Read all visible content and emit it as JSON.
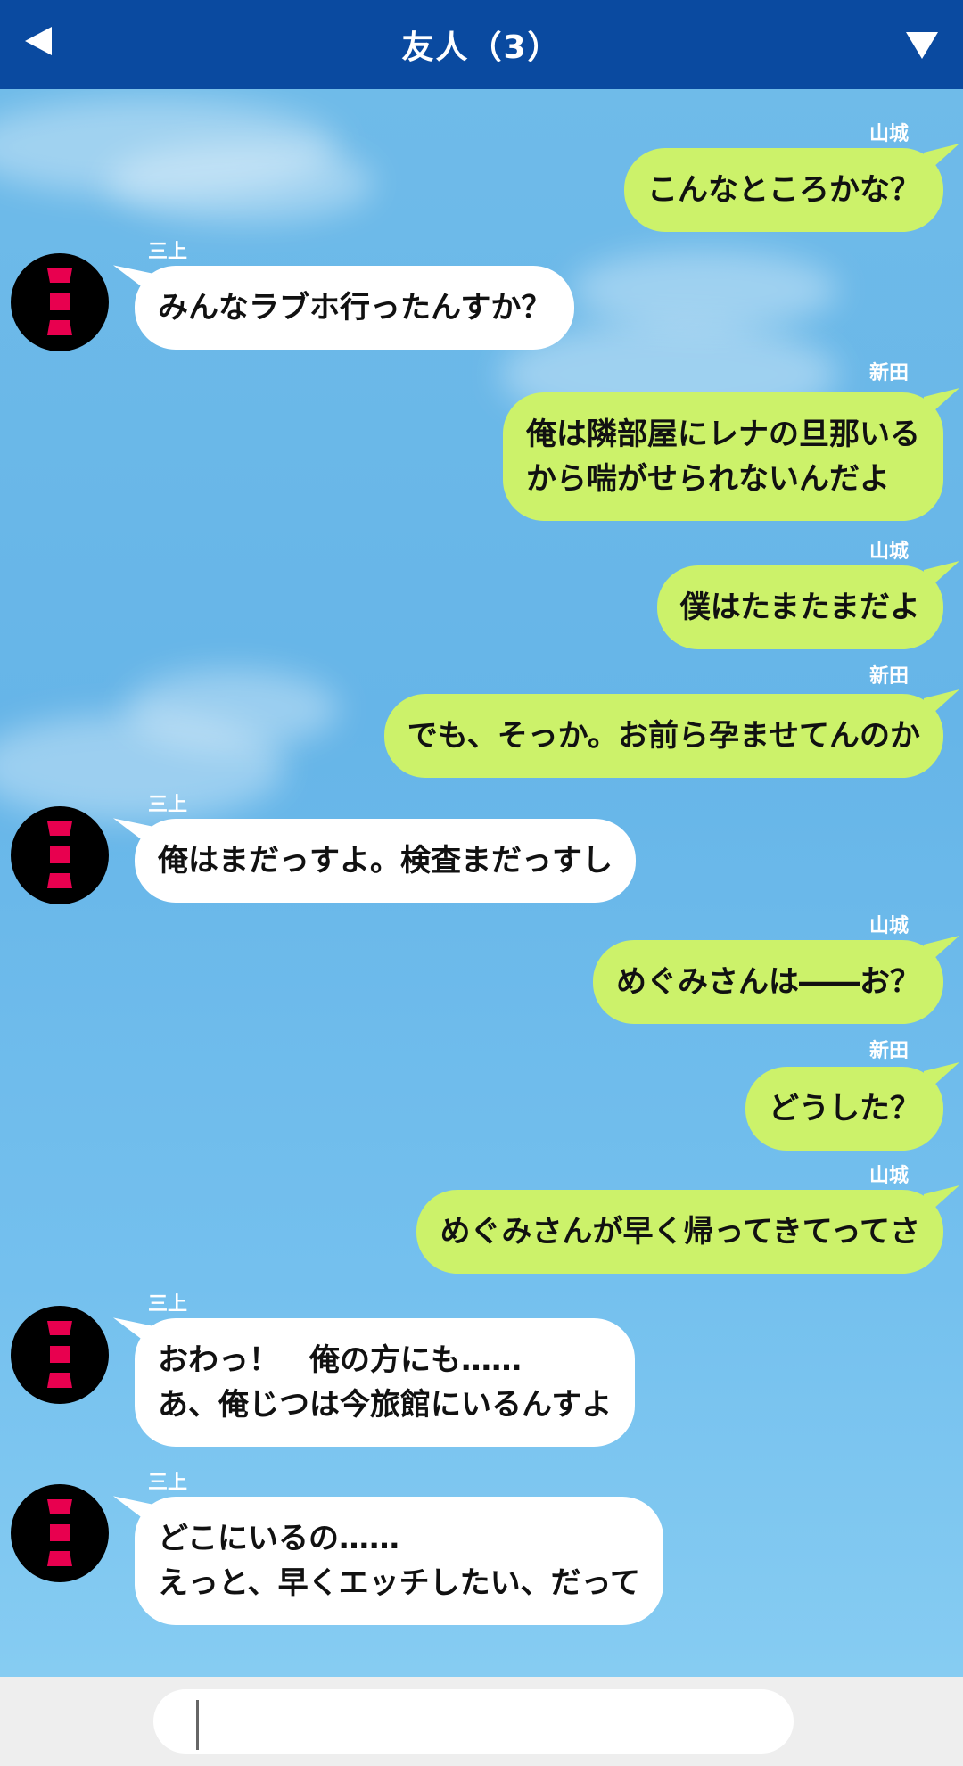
{
  "header": {
    "title": "友人（3）"
  },
  "colors": {
    "header_bg": "#0a4aa0",
    "right_bubble": "#ccf26a",
    "left_bubble": "#ffffff",
    "avatar_mark": "#e8004f"
  },
  "icons": {
    "back": "back-arrow-icon",
    "menu": "dropdown-triangle-icon"
  },
  "messages": [
    {
      "sender": "山城",
      "text": "こんなところかな？"
    },
    {
      "sender": "三上",
      "text": "みんなラブホ行ったんすか？"
    },
    {
      "sender": "新田",
      "text": "俺は隣部屋にレナの旦那いる\nから喘がせられないんだよ"
    },
    {
      "sender": "山城",
      "text": "僕はたまたまだよ"
    },
    {
      "sender": "新田",
      "text": "でも、そっか。お前ら孕ませてんのか"
    },
    {
      "sender": "三上",
      "text": "俺はまだっすよ。検査まだっすし"
    },
    {
      "sender": "山城",
      "text": "めぐみさんは――お？"
    },
    {
      "sender": "新田",
      "text": "どうした？"
    },
    {
      "sender": "山城",
      "text": "めぐみさんが早く帰ってきてってさ"
    },
    {
      "sender": "三上",
      "text": "おわっ！　俺の方にも……\nあ、俺じつは今旅館にいるんすよ"
    },
    {
      "sender": "三上",
      "text": "どこにいるの……\nえっと、早くエッチしたい、だって"
    }
  ]
}
